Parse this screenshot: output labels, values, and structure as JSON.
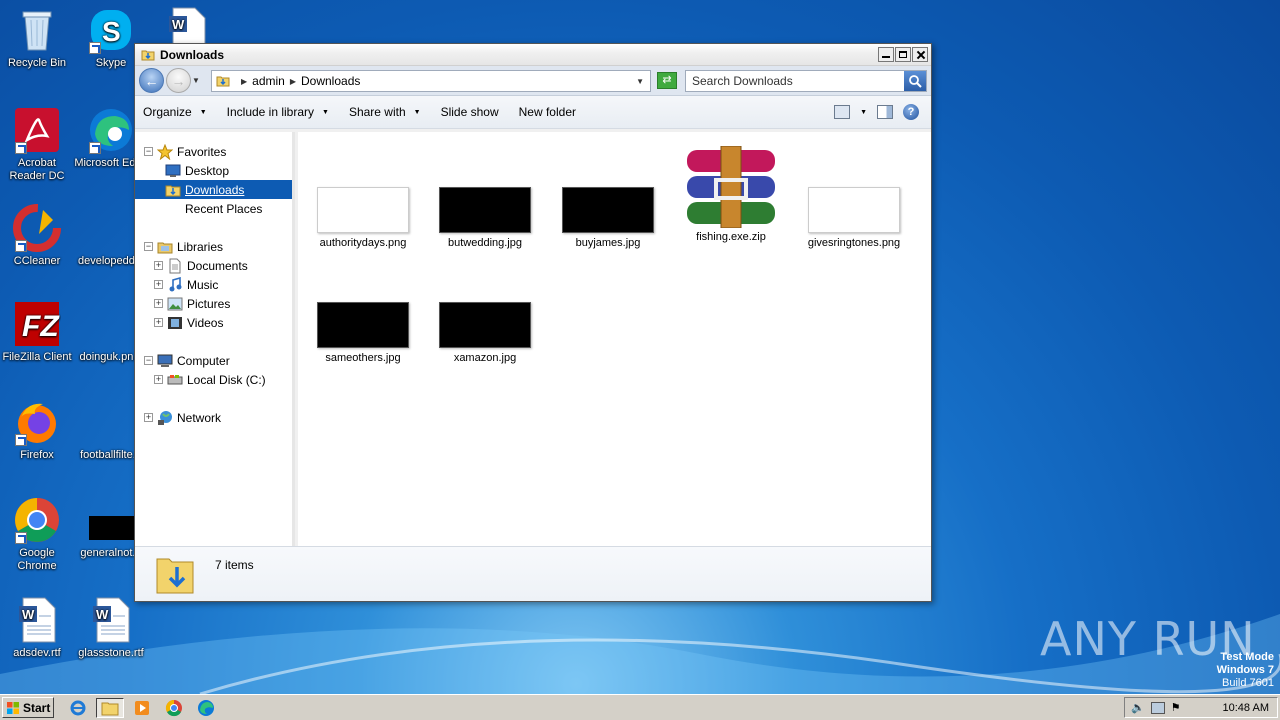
{
  "desktop": {
    "icons": [
      {
        "label": "Recycle Bin"
      },
      {
        "label": "Skype"
      },
      {
        "label": "Acrobat Reader DC"
      },
      {
        "label": "Microsoft Edge"
      },
      {
        "label": "CCleaner"
      },
      {
        "label": "developedd..."
      },
      {
        "label": "FileZilla Client"
      },
      {
        "label": "doinguk.pn..."
      },
      {
        "label": "Firefox"
      },
      {
        "label": "footballfilte..."
      },
      {
        "label": "Google Chrome"
      },
      {
        "label": "generalnot..."
      },
      {
        "label": "adsdev.rtf"
      },
      {
        "label": "glassstone.rtf"
      }
    ]
  },
  "window": {
    "title": "Downloads",
    "address": {
      "crumbs": [
        "admin",
        "Downloads"
      ]
    },
    "search_placeholder": "Search Downloads",
    "toolbar": {
      "organize": "Organize",
      "include_in_library": "Include in library",
      "share_with": "Share with",
      "slide_show": "Slide show",
      "new_folder": "New folder"
    },
    "nav": {
      "favorites": "Favorites",
      "desktop": "Desktop",
      "downloads": "Downloads",
      "recent_places": "Recent Places",
      "libraries": "Libraries",
      "documents": "Documents",
      "music": "Music",
      "pictures": "Pictures",
      "videos": "Videos",
      "computer": "Computer",
      "local_disk": "Local Disk (C:)",
      "network": "Network"
    },
    "files": [
      {
        "name": "authoritydays.png"
      },
      {
        "name": "butwedding.jpg"
      },
      {
        "name": "buyjames.jpg"
      },
      {
        "name": "fishing.exe.zip"
      },
      {
        "name": "givesringtones.png"
      },
      {
        "name": "sameothers.jpg"
      },
      {
        "name": "xamazon.jpg"
      }
    ],
    "status": {
      "item_count": "7 items"
    }
  },
  "taskbar": {
    "start_label": "Start",
    "clock": "10:48 AM"
  },
  "watermark": {
    "line1": "Test Mode",
    "line2": "Windows 7",
    "line3": "Build 7601",
    "brand": "ANY RUN"
  },
  "colors": {
    "selection": "#0d5bb3",
    "desktop": "#166fc7"
  }
}
